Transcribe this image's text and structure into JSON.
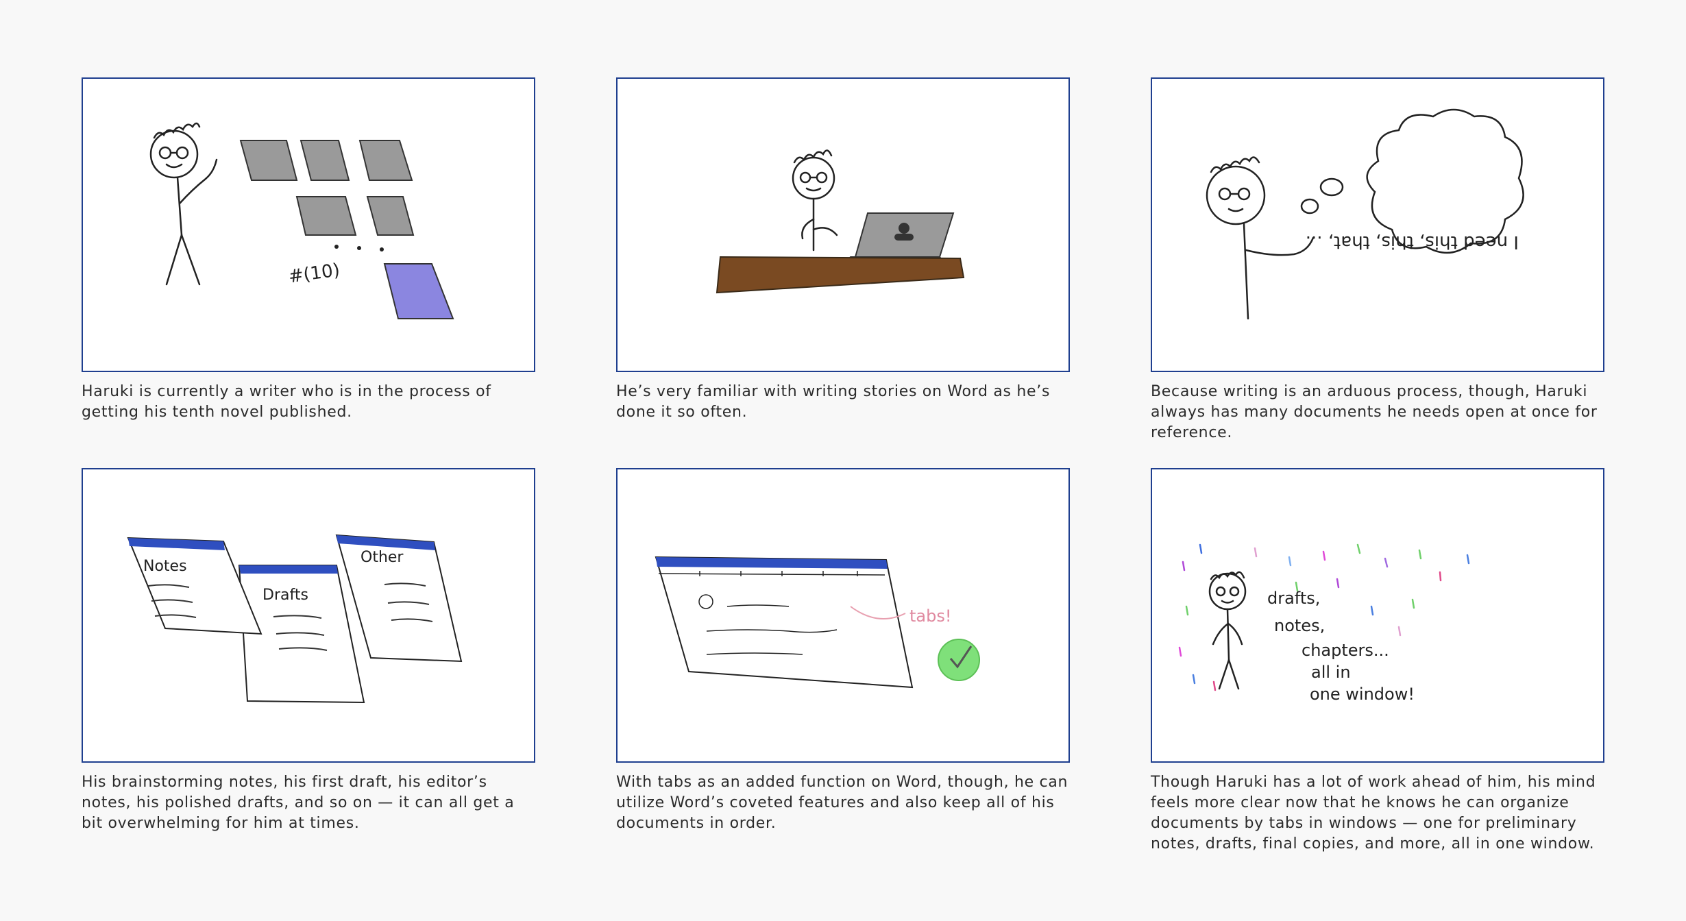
{
  "panels": [
    {
      "caption": "Haruki is currently a writer who is in the process of getting his tenth novel published.",
      "sketch_text": "#(10)"
    },
    {
      "caption": "He’s very familiar with writing stories on Word as he’s done it so often."
    },
    {
      "caption": "Because writing is an arduous process, though, Haruki always has many documents he needs open at once for reference.",
      "sketch_text": "I need this, this, that, ..."
    },
    {
      "caption": "His brainstorming notes, his first draft, his editor’s notes, his polished drafts, and so on — it can all get a bit overwhelming for him at times.",
      "sketch_labels": [
        "Notes",
        "Drafts",
        "Other"
      ]
    },
    {
      "caption": "With tabs as an added function on Word, though, he can utilize Word’s coveted features and also keep all of his documents in order.",
      "sketch_text": "tabs!"
    },
    {
      "caption": "Though Haruki has a lot of work ahead of him, his mind feels more clear now that he knows he can organize documents by tabs in windows — one for preliminary notes, drafts, final copies, and more, all in one window.",
      "sketch_lines": [
        "drafts,",
        "notes,",
        "chapters...",
        "all in",
        "one window!"
      ]
    }
  ],
  "colors": {
    "frame_border": "#1f3f8f",
    "caption_text": "#2b2b2b",
    "background": "#f8f8f8",
    "title_bar": "#2f4fc0",
    "desk": "#7a4a22",
    "highlight_sheet": "#8b86e0",
    "check_badge": "#7fe07a"
  }
}
